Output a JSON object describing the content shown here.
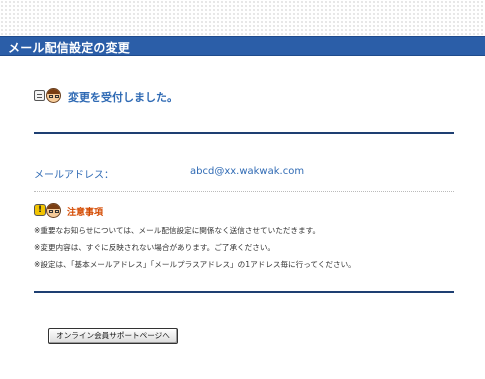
{
  "header": {
    "title": "メール配信設定の変更"
  },
  "message": {
    "text": "変更を受付しました。",
    "icon": "memo-face-icon"
  },
  "email": {
    "label": "メールアドレス：",
    "value": "abcd@xx.wakwak.com"
  },
  "notice": {
    "title": "注意事項",
    "icon": "warning-face-icon",
    "lines": [
      "※重要なお知らせについては、メール配信設定に関係なく送信させていただきます。",
      "※変更内容は、すぐに反映されない場合があります。ご了承ください。",
      "※設定は、「基本メールアドレス」「メールプラスアドレス」の1アドレス毎に行ってください。"
    ]
  },
  "buttons": {
    "support_label": "オンライン会員サポートページへ"
  },
  "colors": {
    "header_bg": "#2b5ea8",
    "accent_text": "#2f6ab4",
    "notice_title": "#d44a00",
    "rule": "#1e3f72"
  }
}
